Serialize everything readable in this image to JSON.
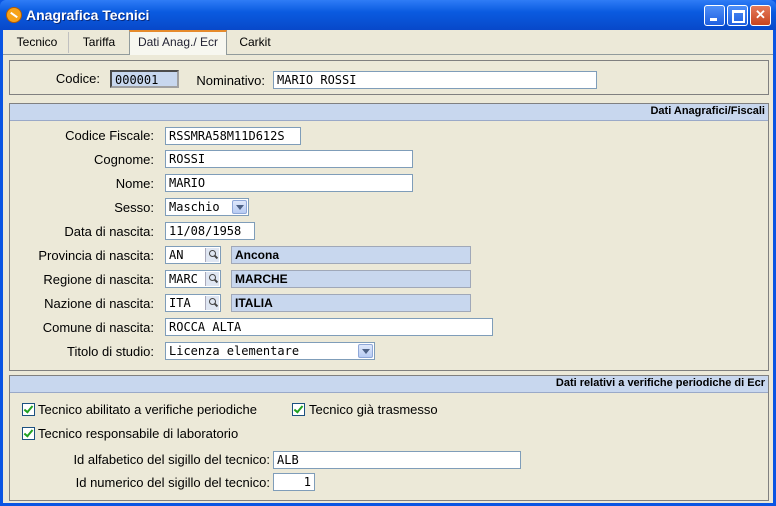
{
  "window": {
    "title": "Anagrafica Tecnici"
  },
  "tabs": [
    "Tecnico",
    "Tariffa",
    "Dati Anag./ Ecr",
    "Carkit"
  ],
  "header": {
    "codice_label": "Codice:",
    "codice_value": "000001",
    "nominativo_label": "Nominativo:",
    "nominativo_value": "MARIO ROSSI"
  },
  "anagrafica": {
    "title": "Dati Anagrafici/Fiscali",
    "codice_fiscale_label": "Codice Fiscale:",
    "codice_fiscale_value": "RSSMRA58M11D612S",
    "cognome_label": "Cognome:",
    "cognome_value": "ROSSI",
    "nome_label": "Nome:",
    "nome_value": "MARIO",
    "sesso_label": "Sesso:",
    "sesso_value": "Maschio",
    "data_nascita_label": "Data di nascita:",
    "data_nascita_value": "11/08/1958",
    "provincia_label": "Provincia di nascita:",
    "provincia_code": "AN",
    "provincia_desc": "Ancona",
    "regione_label": "Regione di nascita:",
    "regione_code": "MARC",
    "regione_desc": "MARCHE",
    "nazione_label": "Nazione di nascita:",
    "nazione_code": "ITA",
    "nazione_desc": "ITALIA",
    "comune_label": "Comune di nascita:",
    "comune_value": "ROCCA ALTA",
    "titolo_label": "Titolo di studio:",
    "titolo_value": "Licenza elementare"
  },
  "ecr": {
    "title": "Dati relativi a verifiche periodiche di Ecr",
    "abilitato_label": "Tecnico abilitato a verifiche periodiche",
    "abilitato_checked": true,
    "trasmesso_label": "Tecnico già trasmesso",
    "trasmesso_checked": true,
    "responsabile_label": "Tecnico responsabile di laboratorio",
    "responsabile_checked": true,
    "id_alfa_label": "Id alfabetico del sigillo del tecnico:",
    "id_alfa_value": "ALB",
    "id_num_label": "Id numerico del sigillo del tecnico:",
    "id_num_value": "1"
  }
}
